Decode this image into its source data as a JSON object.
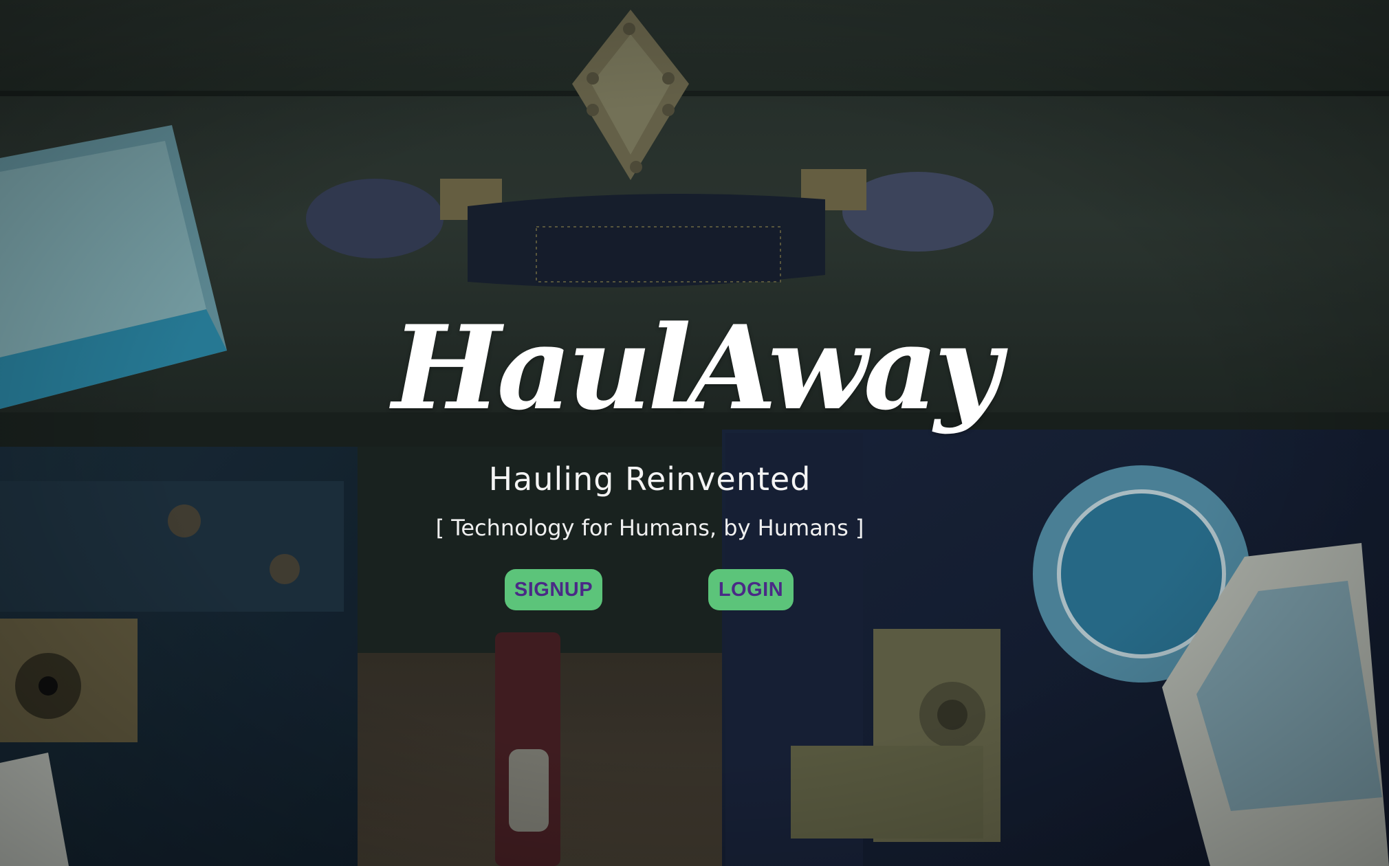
{
  "brand": {
    "logo_text": "HaulAway"
  },
  "hero": {
    "tagline": "Hauling Reinvented",
    "subtagline": "[ Technology for Humans, by Humans ]"
  },
  "actions": {
    "signup_label": "SIGNUP",
    "login_label": "LOGIN"
  },
  "theme": {
    "button_bg": "#5cc47a",
    "button_text": "#4a2a86",
    "text": "#ffffff"
  }
}
